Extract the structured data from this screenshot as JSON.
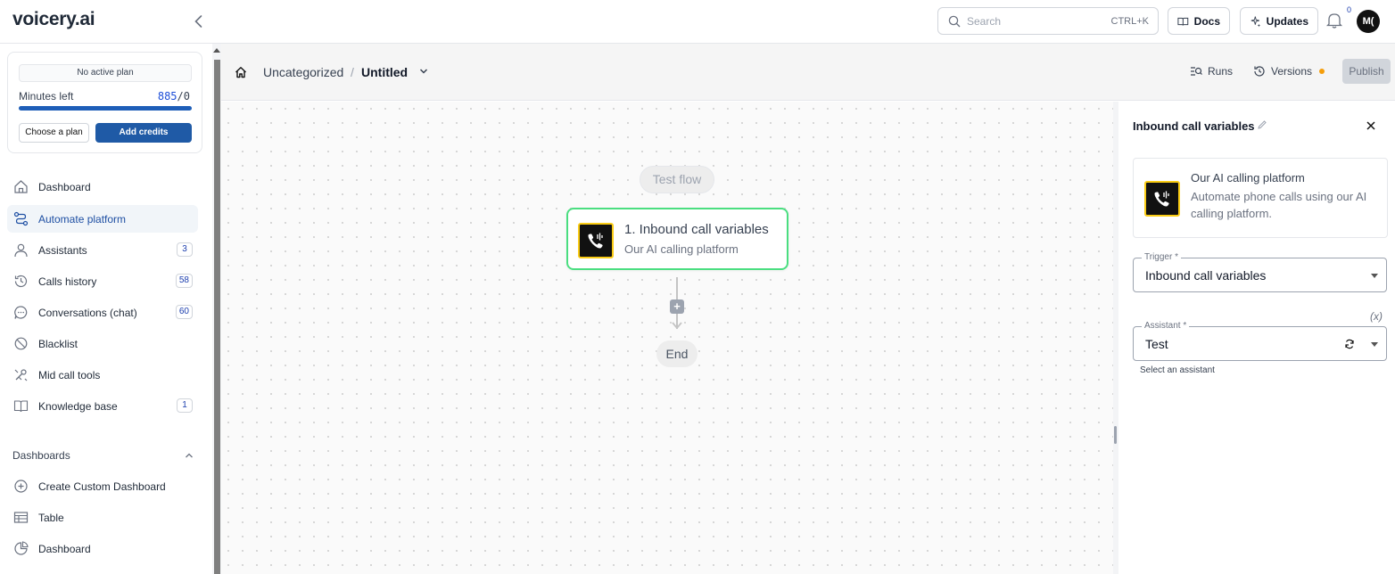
{
  "app": {
    "logo": "voicery.ai"
  },
  "topbar": {
    "search_placeholder": "Search",
    "search_shortcut": "CTRL+K",
    "docs_label": "Docs",
    "updates_label": "Updates",
    "notifications_count": "0",
    "avatar_initials": "M("
  },
  "plan": {
    "status": "No active plan",
    "minutes_label": "Minutes left",
    "minutes_left": "885",
    "minutes_total": "/0",
    "progress_fraction": 1.0,
    "choose_plan_label": "Choose a plan",
    "add_credits_label": "Add credits"
  },
  "sidebar": {
    "items": [
      {
        "label": "Dashboard",
        "icon": "home-icon",
        "count": ""
      },
      {
        "label": "Automate platform",
        "icon": "workflow-icon",
        "count": "",
        "active": true
      },
      {
        "label": "Assistants",
        "icon": "user-icon",
        "count": "3"
      },
      {
        "label": "Calls history",
        "icon": "history-icon",
        "count": "58"
      },
      {
        "label": "Conversations (chat)",
        "icon": "chat-icon",
        "count": "60"
      },
      {
        "label": "Blacklist",
        "icon": "ban-icon",
        "count": ""
      },
      {
        "label": "Mid call tools",
        "icon": "tools-icon",
        "count": ""
      },
      {
        "label": "Knowledge base",
        "icon": "book-icon",
        "count": "1"
      }
    ],
    "dashboards_heading": "Dashboards",
    "dashboard_items": [
      {
        "label": "Create Custom Dashboard",
        "icon": "plus-circle-icon"
      },
      {
        "label": "Table",
        "icon": "table-icon"
      },
      {
        "label": "Dashboard",
        "icon": "pie-chart-icon"
      }
    ]
  },
  "header": {
    "breadcrumb_folder": "Uncategorized",
    "breadcrumb_separator": "/",
    "flow_name": "Untitled",
    "runs_label": "Runs",
    "versions_label": "Versions",
    "publish_label": "Publish"
  },
  "canvas": {
    "test_flow_label": "Test flow",
    "step": {
      "title": "1. Inbound call variables",
      "subtitle": "Our AI calling platform"
    },
    "end_label": "End",
    "add_step_symbol": "+"
  },
  "panel": {
    "title": "Inbound call variables",
    "app_name": "Our AI calling platform",
    "app_description": "Automate phone calls using our AI calling platform.",
    "trigger_label": "Trigger *",
    "trigger_value": "Inbound call variables",
    "fx_label": "(x)",
    "assistant_label": "Assistant *",
    "assistant_value": "Test",
    "assistant_helper": "Select an assistant"
  },
  "colors": {
    "primary": "#1f5aa6",
    "step_border": "#4ade80",
    "logo_border": "#facc15",
    "versions_dot": "#f59e0b"
  }
}
